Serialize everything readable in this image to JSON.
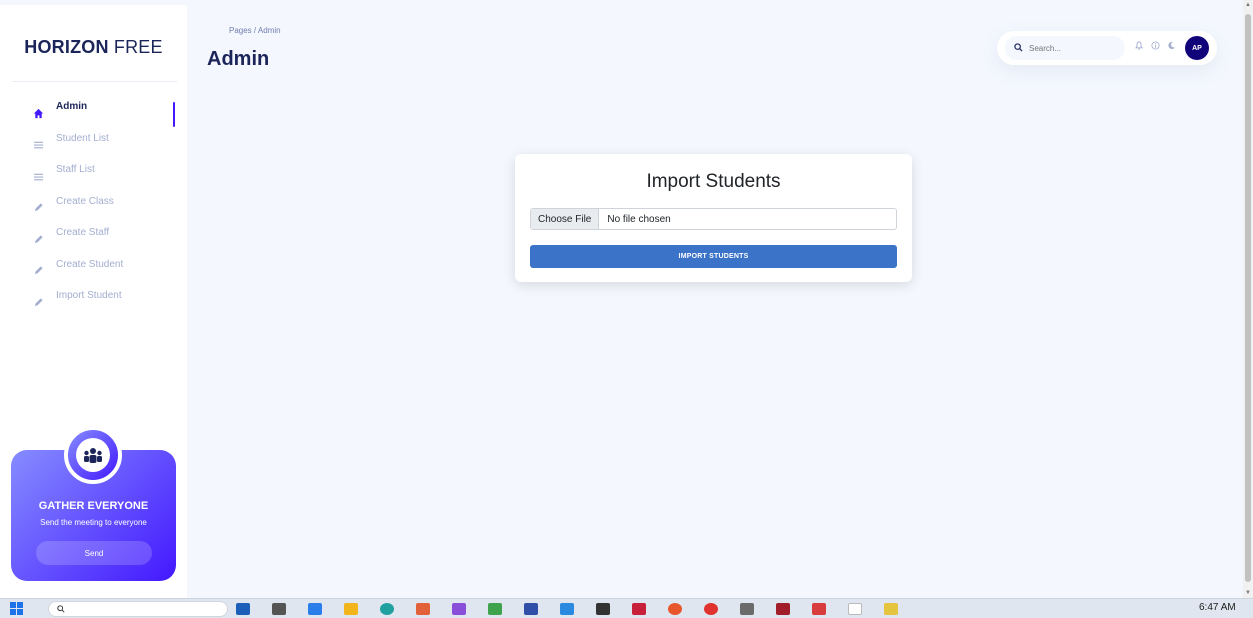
{
  "brand": {
    "bold": "HORIZON",
    "light": "FREE"
  },
  "sidebar": {
    "items": [
      {
        "label": "Admin",
        "icon": "home-icon"
      },
      {
        "label": "Student List",
        "icon": "list-icon"
      },
      {
        "label": "Staff List",
        "icon": "list-icon"
      },
      {
        "label": "Create Class",
        "icon": "pencil-icon"
      },
      {
        "label": "Create Staff",
        "icon": "pencil-icon"
      },
      {
        "label": "Create Student",
        "icon": "pencil-icon"
      },
      {
        "label": "Import Student",
        "icon": "pencil-icon"
      }
    ],
    "promo": {
      "title": "GATHER EVERYONE",
      "subtitle": "Send the meeting to everyone",
      "button": "Send"
    }
  },
  "header": {
    "breadcrumb": "Pages / Admin",
    "title": "Admin",
    "search_placeholder": "Search...",
    "avatar_initials": "AP"
  },
  "import_card": {
    "title": "Import Students",
    "file_button": "Choose File",
    "file_status": "No file chosen",
    "submit_label": "IMPORT STUDENTS"
  },
  "taskbar": {
    "time": "6:47 AM"
  },
  "colors": {
    "accent": "#4318ff",
    "navy": "#1b2559",
    "import_button": "#3b73c8",
    "background": "#f4f7fe"
  }
}
